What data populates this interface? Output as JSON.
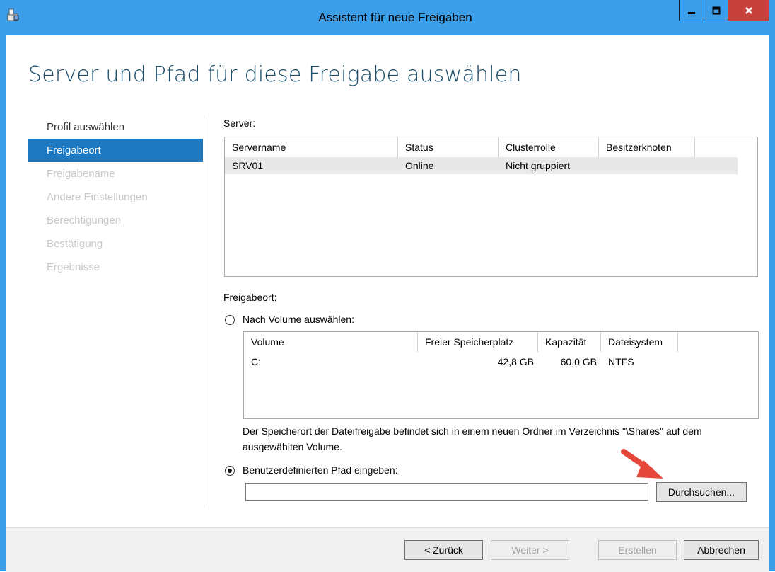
{
  "window": {
    "title": "Assistent für neue Freigaben",
    "controls": {
      "minimize": "minimize-icon",
      "maximize": "maximize-icon",
      "close": "close-icon"
    },
    "accent_color": "#3c9ee8",
    "close_color": "#c7403a"
  },
  "page": {
    "heading": "Server und Pfad für diese Freigabe auswählen"
  },
  "nav": {
    "items": [
      {
        "label": "Profil auswählen",
        "state": "done"
      },
      {
        "label": "Freigabeort",
        "state": "active"
      },
      {
        "label": "Freigabename",
        "state": "disabled"
      },
      {
        "label": "Andere Einstellungen",
        "state": "disabled"
      },
      {
        "label": "Berechtigungen",
        "state": "disabled"
      },
      {
        "label": "Bestätigung",
        "state": "disabled"
      },
      {
        "label": "Ergebnisse",
        "state": "disabled"
      }
    ],
    "active_color": "#1c78c0"
  },
  "server": {
    "label": "Server:",
    "columns": [
      "Servername",
      "Status",
      "Clusterrolle",
      "Besitzerknoten"
    ],
    "rows": [
      {
        "name": "SRV01",
        "status": "Online",
        "role": "Nicht gruppiert",
        "owner": ""
      }
    ]
  },
  "location": {
    "label": "Freigabeort:",
    "by_volume": {
      "label": "Nach Volume auswählen:",
      "selected": false,
      "columns": [
        "Volume",
        "Freier Speicherplatz",
        "Kapazität",
        "Dateisystem"
      ],
      "rows": [
        {
          "volume": "C:",
          "free": "42,8 GB",
          "capacity": "60,0 GB",
          "fs": "NTFS"
        }
      ],
      "description": "Der Speicherort der Dateifreigabe befindet sich in einem neuen Ordner im Verzeichnis \"\\Shares\" auf dem ausgewählten Volume."
    },
    "custom_path": {
      "label": "Benutzerdefinierten Pfad eingeben:",
      "selected": true,
      "value": "",
      "browse_label": "Durchsuchen..."
    }
  },
  "footer": {
    "back": "< Zurück",
    "next": "Weiter >",
    "create": "Erstellen",
    "cancel": "Abbrechen"
  },
  "annotation": {
    "arrow_color": "#e5473a",
    "icon": "pointer-arrow-icon"
  }
}
